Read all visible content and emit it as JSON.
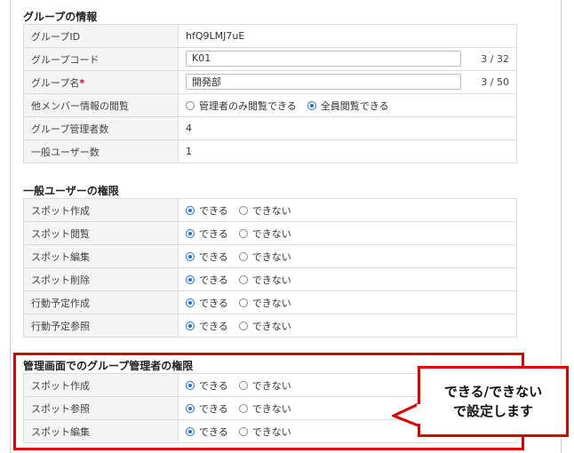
{
  "group_info": {
    "title": "グループの情報",
    "rows": {
      "group_id": {
        "label": "グループID",
        "value": "hfQ9LMJ7uE"
      },
      "group_code": {
        "label": "グループコード",
        "value": "K01",
        "counter": "3 / 32"
      },
      "group_name": {
        "label": "グループ名",
        "required_mark": "*",
        "value": "開発部",
        "counter": "3 / 50"
      },
      "member_view": {
        "label": "他メンバー情報の閲覧",
        "option_admin_only": "管理者のみ閲覧できる",
        "option_all": "全員閲覧できる",
        "selected": "all"
      },
      "admin_count": {
        "label": "グループ管理者数",
        "value": "4"
      },
      "user_count": {
        "label": "一般ユーザー数",
        "value": "1"
      }
    }
  },
  "user_permissions": {
    "title": "一般ユーザーの権限",
    "yes_label": "できる",
    "no_label": "できない",
    "rows": [
      {
        "label": "スポット作成",
        "selected": "yes"
      },
      {
        "label": "スポット閲覧",
        "selected": "yes"
      },
      {
        "label": "スポット編集",
        "selected": "yes"
      },
      {
        "label": "スポット削除",
        "selected": "yes"
      },
      {
        "label": "行動予定作成",
        "selected": "yes"
      },
      {
        "label": "行動予定参照",
        "selected": "yes"
      }
    ]
  },
  "admin_permissions": {
    "title": "管理画面でのグループ管理者の権限",
    "yes_label": "できる",
    "no_label": "できない",
    "rows": [
      {
        "label": "スポット作成",
        "selected": "yes"
      },
      {
        "label": "スポット参照",
        "selected": "yes"
      },
      {
        "label": "スポット編集",
        "selected": "yes"
      }
    ]
  },
  "callout": {
    "line1": "できる/できない",
    "line2": "で設定します"
  },
  "colors": {
    "highlight": "#e00000",
    "radio_selected": "#1a73e8",
    "required": "#d0021b"
  }
}
